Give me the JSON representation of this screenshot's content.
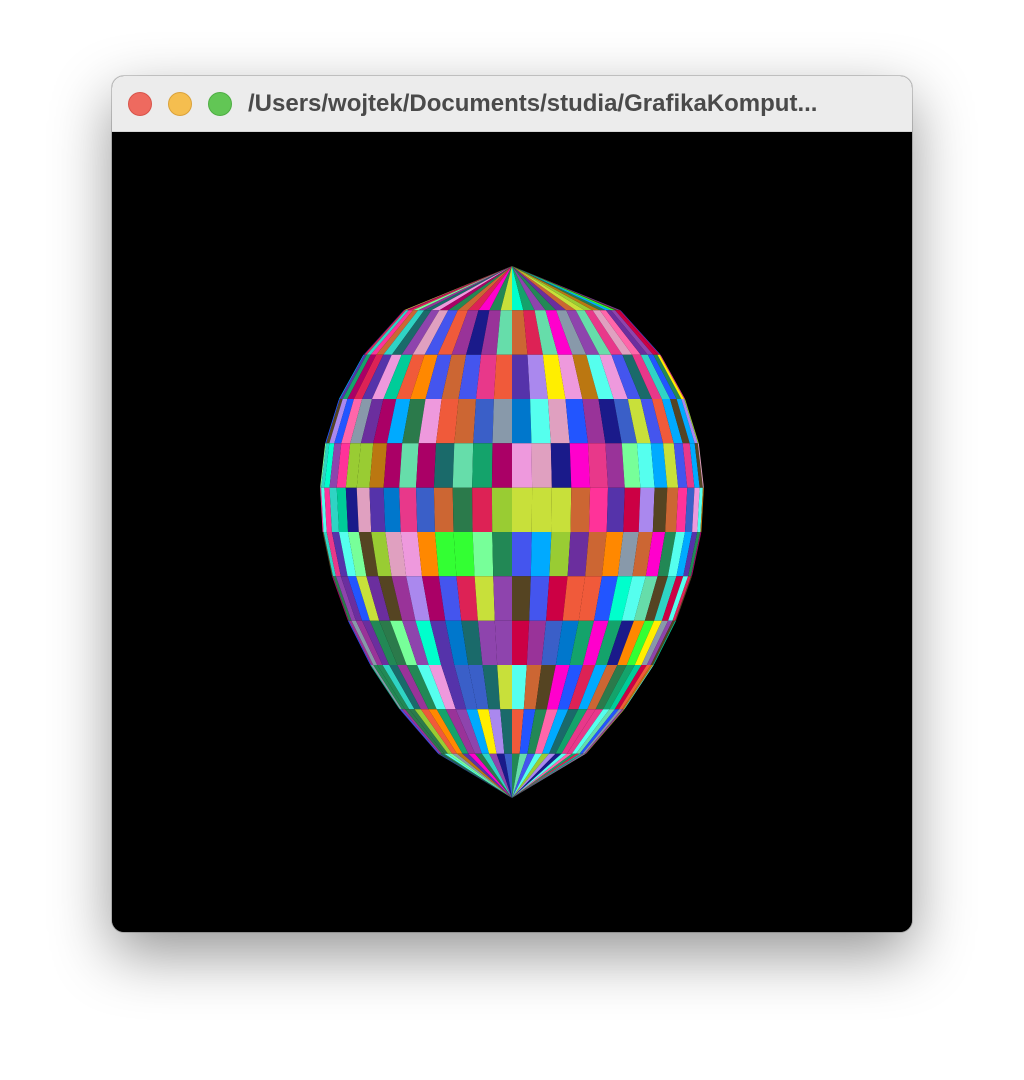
{
  "window": {
    "title": "/Users/wojtek/Documents/studia/GrafikaKomput..."
  },
  "titlebar": {
    "buttons": [
      {
        "name": "close",
        "color": "#ee6a5f"
      },
      {
        "name": "minimize",
        "color": "#f5be4f"
      },
      {
        "name": "zoom",
        "color": "#62c655"
      }
    ]
  },
  "canvas": {
    "background": "#000000",
    "object": "multicolored-egg"
  }
}
